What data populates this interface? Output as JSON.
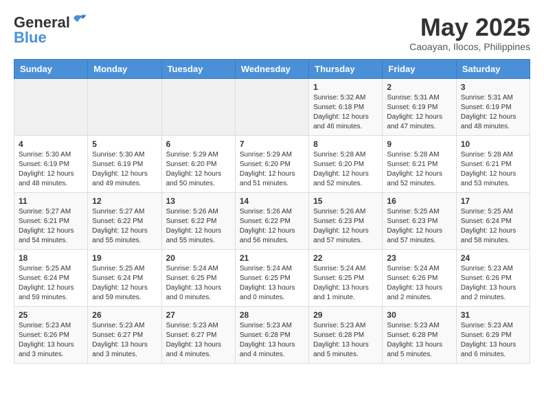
{
  "header": {
    "logo_general": "General",
    "logo_blue": "Blue",
    "month": "May 2025",
    "location": "Caoayan, Ilocos, Philippines"
  },
  "weekdays": [
    "Sunday",
    "Monday",
    "Tuesday",
    "Wednesday",
    "Thursday",
    "Friday",
    "Saturday"
  ],
  "weeks": [
    [
      {
        "day": "",
        "info": ""
      },
      {
        "day": "",
        "info": ""
      },
      {
        "day": "",
        "info": ""
      },
      {
        "day": "",
        "info": ""
      },
      {
        "day": "1",
        "info": "Sunrise: 5:32 AM\nSunset: 6:18 PM\nDaylight: 12 hours\nand 46 minutes."
      },
      {
        "day": "2",
        "info": "Sunrise: 5:31 AM\nSunset: 6:19 PM\nDaylight: 12 hours\nand 47 minutes."
      },
      {
        "day": "3",
        "info": "Sunrise: 5:31 AM\nSunset: 6:19 PM\nDaylight: 12 hours\nand 48 minutes."
      }
    ],
    [
      {
        "day": "4",
        "info": "Sunrise: 5:30 AM\nSunset: 6:19 PM\nDaylight: 12 hours\nand 48 minutes."
      },
      {
        "day": "5",
        "info": "Sunrise: 5:30 AM\nSunset: 6:19 PM\nDaylight: 12 hours\nand 49 minutes."
      },
      {
        "day": "6",
        "info": "Sunrise: 5:29 AM\nSunset: 6:20 PM\nDaylight: 12 hours\nand 50 minutes."
      },
      {
        "day": "7",
        "info": "Sunrise: 5:29 AM\nSunset: 6:20 PM\nDaylight: 12 hours\nand 51 minutes."
      },
      {
        "day": "8",
        "info": "Sunrise: 5:28 AM\nSunset: 6:20 PM\nDaylight: 12 hours\nand 52 minutes."
      },
      {
        "day": "9",
        "info": "Sunrise: 5:28 AM\nSunset: 6:21 PM\nDaylight: 12 hours\nand 52 minutes."
      },
      {
        "day": "10",
        "info": "Sunrise: 5:28 AM\nSunset: 6:21 PM\nDaylight: 12 hours\nand 53 minutes."
      }
    ],
    [
      {
        "day": "11",
        "info": "Sunrise: 5:27 AM\nSunset: 6:21 PM\nDaylight: 12 hours\nand 54 minutes."
      },
      {
        "day": "12",
        "info": "Sunrise: 5:27 AM\nSunset: 6:22 PM\nDaylight: 12 hours\nand 55 minutes."
      },
      {
        "day": "13",
        "info": "Sunrise: 5:26 AM\nSunset: 6:22 PM\nDaylight: 12 hours\nand 55 minutes."
      },
      {
        "day": "14",
        "info": "Sunrise: 5:26 AM\nSunset: 6:22 PM\nDaylight: 12 hours\nand 56 minutes."
      },
      {
        "day": "15",
        "info": "Sunrise: 5:26 AM\nSunset: 6:23 PM\nDaylight: 12 hours\nand 57 minutes."
      },
      {
        "day": "16",
        "info": "Sunrise: 5:25 AM\nSunset: 6:23 PM\nDaylight: 12 hours\nand 57 minutes."
      },
      {
        "day": "17",
        "info": "Sunrise: 5:25 AM\nSunset: 6:24 PM\nDaylight: 12 hours\nand 58 minutes."
      }
    ],
    [
      {
        "day": "18",
        "info": "Sunrise: 5:25 AM\nSunset: 6:24 PM\nDaylight: 12 hours\nand 59 minutes."
      },
      {
        "day": "19",
        "info": "Sunrise: 5:25 AM\nSunset: 6:24 PM\nDaylight: 12 hours\nand 59 minutes."
      },
      {
        "day": "20",
        "info": "Sunrise: 5:24 AM\nSunset: 6:25 PM\nDaylight: 13 hours\nand 0 minutes."
      },
      {
        "day": "21",
        "info": "Sunrise: 5:24 AM\nSunset: 6:25 PM\nDaylight: 13 hours\nand 0 minutes."
      },
      {
        "day": "22",
        "info": "Sunrise: 5:24 AM\nSunset: 6:25 PM\nDaylight: 13 hours\nand 1 minute."
      },
      {
        "day": "23",
        "info": "Sunrise: 5:24 AM\nSunset: 6:26 PM\nDaylight: 13 hours\nand 2 minutes."
      },
      {
        "day": "24",
        "info": "Sunrise: 5:23 AM\nSunset: 6:26 PM\nDaylight: 13 hours\nand 2 minutes."
      }
    ],
    [
      {
        "day": "25",
        "info": "Sunrise: 5:23 AM\nSunset: 6:26 PM\nDaylight: 13 hours\nand 3 minutes."
      },
      {
        "day": "26",
        "info": "Sunrise: 5:23 AM\nSunset: 6:27 PM\nDaylight: 13 hours\nand 3 minutes."
      },
      {
        "day": "27",
        "info": "Sunrise: 5:23 AM\nSunset: 6:27 PM\nDaylight: 13 hours\nand 4 minutes."
      },
      {
        "day": "28",
        "info": "Sunrise: 5:23 AM\nSunset: 6:28 PM\nDaylight: 13 hours\nand 4 minutes."
      },
      {
        "day": "29",
        "info": "Sunrise: 5:23 AM\nSunset: 6:28 PM\nDaylight: 13 hours\nand 5 minutes."
      },
      {
        "day": "30",
        "info": "Sunrise: 5:23 AM\nSunset: 6:28 PM\nDaylight: 13 hours\nand 5 minutes."
      },
      {
        "day": "31",
        "info": "Sunrise: 5:23 AM\nSunset: 6:29 PM\nDaylight: 13 hours\nand 6 minutes."
      }
    ]
  ]
}
